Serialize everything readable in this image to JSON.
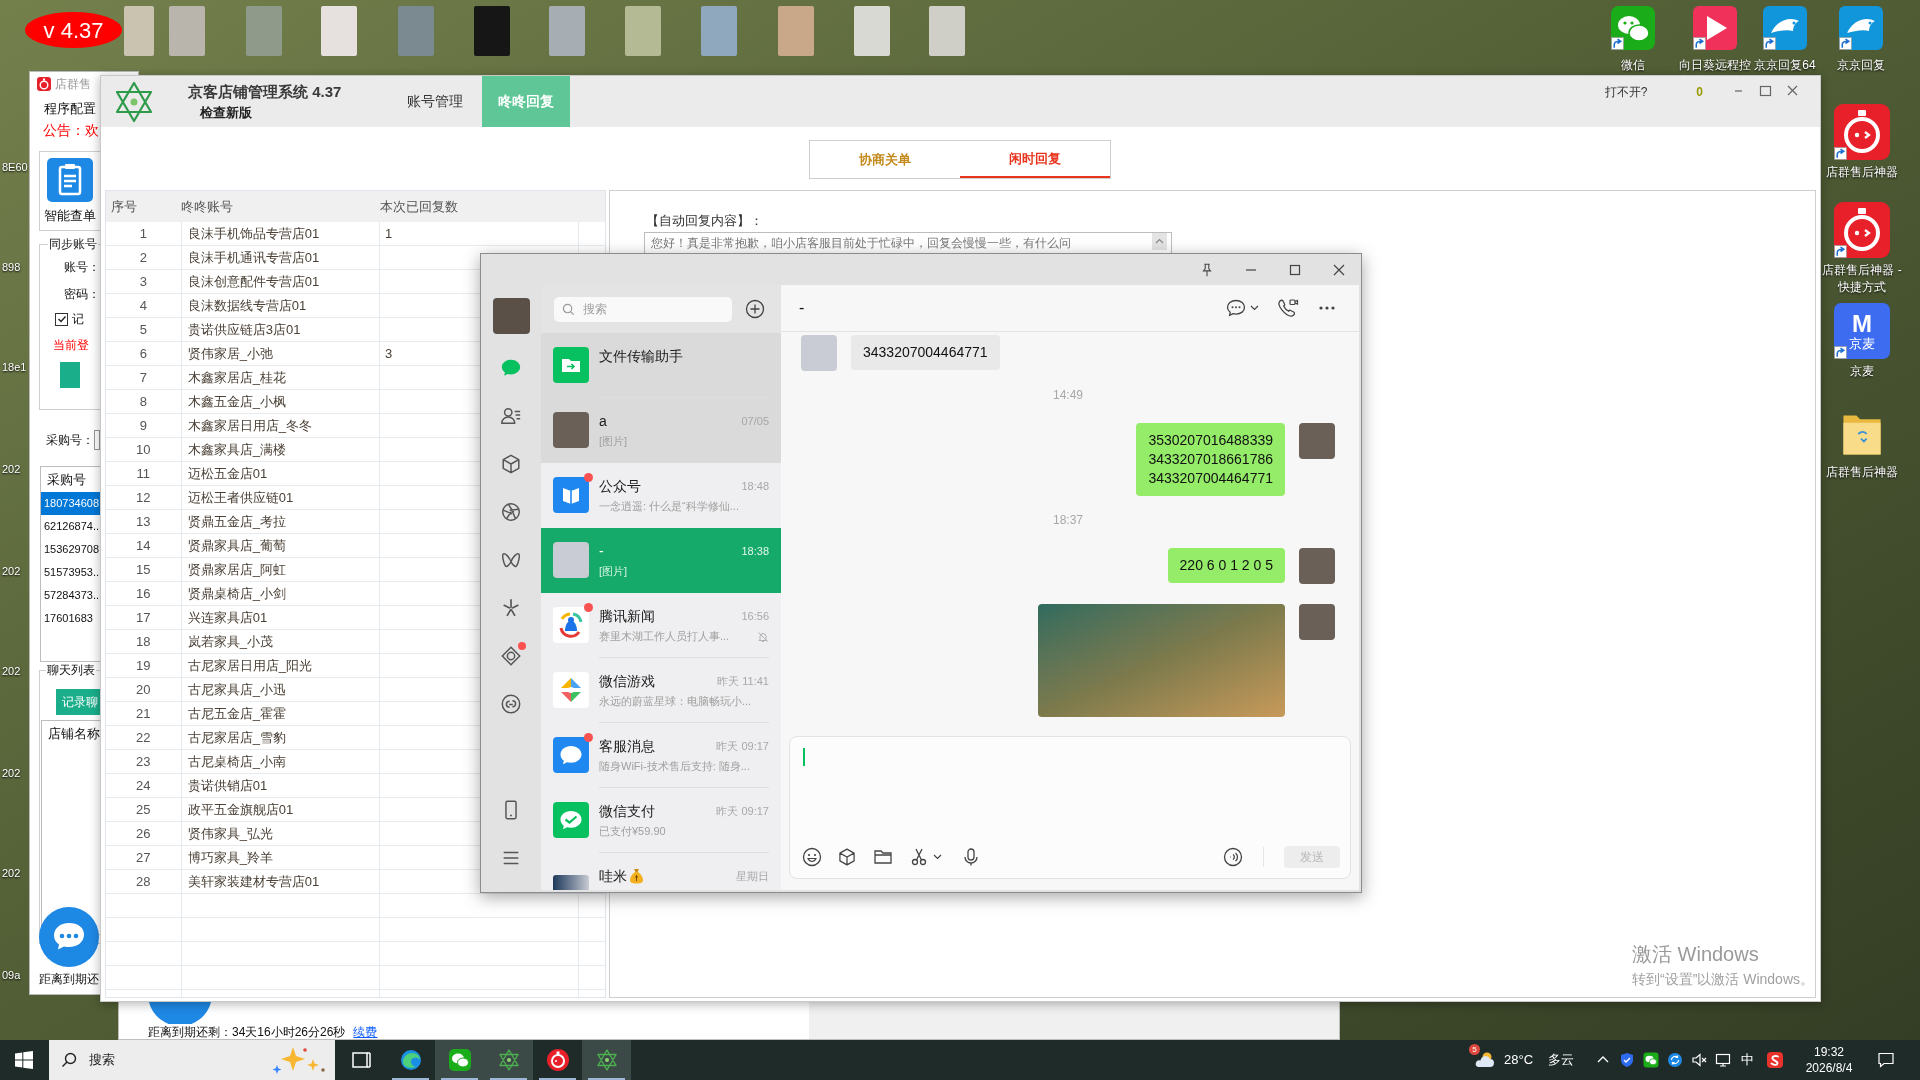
{
  "version_badge": "v 4.37",
  "desktop": {
    "left_labels": [
      "8E60",
      "898",
      "18e1",
      "202",
      "202",
      "202",
      "202",
      "202",
      "09a"
    ],
    "top_icons": [
      {
        "label": "微信",
        "kind": "wechat",
        "shortcut": true
      },
      {
        "label": "向日葵远程控",
        "kind": "remote",
        "shortcut": true
      },
      {
        "label": "京京回复64",
        "kind": "bird",
        "shortcut": true
      },
      {
        "label": "京京回复",
        "kind": "bird",
        "shortcut": true
      }
    ],
    "side_icons": [
      {
        "label": "店群售后神器",
        "kind": "alarm",
        "shortcut": true
      },
      {
        "label": "店群售后神器 - 快捷方式",
        "kind": "alarm",
        "shortcut": true
      },
      {
        "label": "京麦",
        "kind": "logo",
        "logo_letter": "M",
        "logo_text": "京麦",
        "shortcut": true
      },
      {
        "label": "店群售后神器",
        "kind": "folder",
        "shortcut": false
      }
    ]
  },
  "back_window": {
    "title": "店群售",
    "menu": "程序配置",
    "notice": "公告：欢",
    "tool": "智能查单",
    "sync": {
      "title": "同步账号",
      "account_label": "账号：",
      "password_label": "密码：",
      "remember": {
        "label": "记",
        "checked": true
      },
      "status": "当前登"
    },
    "purchase": {
      "label": "采购号：",
      "header": "采购号",
      "rows": [
        {
          "text": "180734608",
          "selected": true
        },
        {
          "text": "62126874..",
          "selected": false
        },
        {
          "text": "153629708",
          "selected": false
        },
        {
          "text": "51573953..",
          "selected": false
        },
        {
          "text": "57284373..",
          "selected": false
        },
        {
          "text": "17601683",
          "selected": false
        }
      ]
    },
    "chat_log": {
      "title": "聊天列表",
      "button": "记录聊",
      "list_header": "店铺名称"
    },
    "expiry": "距离到期还"
  },
  "lower_window": {
    "expiry": "距离到期还剩：34天16小时26分26秒",
    "renew": "续费"
  },
  "main_window": {
    "title": "京客店铺管理系统 4.37",
    "update": "检查新版",
    "nav_tabs": [
      {
        "label": "账号管理",
        "selected": false
      },
      {
        "label": "咚咚回复",
        "selected": true
      }
    ],
    "help": "打不开?",
    "counter": "0",
    "mode_tabs": [
      {
        "label": "协商关单",
        "selected": false
      },
      {
        "label": "闲时回复",
        "selected": true
      }
    ],
    "table": {
      "columns": [
        "序号",
        "咚咚账号",
        "本次已回复数"
      ],
      "rows": [
        {
          "no": "1",
          "account": "良沫手机饰品专营店01",
          "replies": "1"
        },
        {
          "no": "2",
          "account": "良沫手机通讯专营店01"
        },
        {
          "no": "3",
          "account": "良沫创意配件专营店01"
        },
        {
          "no": "4",
          "account": "良沫数据线专营店01"
        },
        {
          "no": "5",
          "account": "贵诺供应链店3店01"
        },
        {
          "no": "6",
          "account": "贤伟家居_小弛",
          "replies": "3"
        },
        {
          "no": "7",
          "account": "木鑫家居店_桂花"
        },
        {
          "no": "8",
          "account": "木鑫五金店_小枫"
        },
        {
          "no": "9",
          "account": "木鑫家居日用店_冬冬"
        },
        {
          "no": "10",
          "account": "木鑫家具店_满楼"
        },
        {
          "no": "11",
          "account": "迈松五金店01"
        },
        {
          "no": "12",
          "account": "迈松王者供应链01"
        },
        {
          "no": "13",
          "account": "贤鼎五金店_考拉"
        },
        {
          "no": "14",
          "account": "贤鼎家具店_葡萄"
        },
        {
          "no": "15",
          "account": "贤鼎家居店_阿虹"
        },
        {
          "no": "16",
          "account": "贤鼎桌椅店_小剑"
        },
        {
          "no": "17",
          "account": "兴连家具店01"
        },
        {
          "no": "18",
          "account": "岚若家具_小茂"
        },
        {
          "no": "19",
          "account": "古尼家居日用店_阳光"
        },
        {
          "no": "20",
          "account": "古尼家具店_小迅"
        },
        {
          "no": "21",
          "account": "古尼五金店_霍霍"
        },
        {
          "no": "22",
          "account": "古尼家居店_雪豹"
        },
        {
          "no": "23",
          "account": "古尼桌椅店_小南"
        },
        {
          "no": "24",
          "account": "贵诺供销店01"
        },
        {
          "no": "25",
          "account": "政平五金旗舰店01"
        },
        {
          "no": "26",
          "account": "贤伟家具_弘光"
        },
        {
          "no": "27",
          "account": "博巧家具_羚羊"
        },
        {
          "no": "28",
          "account": "美轩家装建材专营店01"
        }
      ]
    },
    "reply": {
      "label": "【自动回复内容】：",
      "text": "您好！真是非常抱歉，咱小店客服目前处于忙碌中，回复会慢慢一些，有什么问"
    }
  },
  "wechat": {
    "nav": [
      {
        "kind": "chat",
        "selected": true,
        "dot": false
      },
      {
        "kind": "contacts",
        "selected": false,
        "dot": false
      },
      {
        "kind": "cube",
        "selected": false,
        "dot": false
      },
      {
        "kind": "aperture",
        "selected": false,
        "dot": false
      },
      {
        "kind": "butterfly",
        "selected": false,
        "dot": false
      },
      {
        "kind": "sparkle",
        "selected": false,
        "dot": false
      },
      {
        "kind": "diamond",
        "selected": false,
        "dot": true
      },
      {
        "kind": "link",
        "selected": false,
        "dot": false
      }
    ],
    "bottom_nav": [
      {
        "kind": "phone"
      },
      {
        "kind": "menu"
      }
    ],
    "search": {
      "placeholder": "搜索"
    },
    "chats": [
      {
        "name": "文件传输助手",
        "avatar": {
          "kind": "file"
        },
        "pinned": true,
        "selected": false,
        "unread": false,
        "muted": false
      },
      {
        "name": "a",
        "time": "07/05",
        "preview": "[图片]",
        "avatar": {
          "kind": "photo"
        },
        "pinned": true,
        "selected": false,
        "unread": false,
        "muted": false
      },
      {
        "name": "公众号",
        "time": "18:48",
        "preview": "一念逍遥: 什么是“科学修仙...",
        "avatar": {
          "kind": "official"
        },
        "pinned": false,
        "selected": false,
        "unread": true,
        "muted": false
      },
      {
        "name": "-",
        "time": "18:38",
        "preview": "[图片]",
        "avatar": {
          "kind": "photo"
        },
        "pinned": false,
        "selected": true,
        "unread": false,
        "muted": false
      },
      {
        "name": "腾讯新闻",
        "time": "16:56",
        "preview": "赛里木湖工作人员打人事...",
        "avatar": {
          "kind": "news"
        },
        "pinned": false,
        "selected": false,
        "unread": true,
        "muted": true
      },
      {
        "name": "微信游戏",
        "time": "昨天 11:41",
        "preview": "永远的蔚蓝星球：电脑畅玩小...",
        "avatar": {
          "kind": "games"
        },
        "pinned": false,
        "selected": false,
        "unread": false,
        "muted": false
      },
      {
        "name": "客服消息",
        "time": "昨天 09:17",
        "preview": "随身WiFi-技术售后支持: 随身...",
        "avatar": {
          "kind": "service"
        },
        "pinned": false,
        "selected": false,
        "unread": true,
        "muted": false
      },
      {
        "name": "微信支付",
        "time": "昨天 09:17",
        "preview": "已支付¥59.90",
        "avatar": {
          "kind": "pay"
        },
        "pinned": false,
        "selected": false,
        "unread": false,
        "muted": false
      },
      {
        "name": "哇米",
        "time": "星期日",
        "avatar": {
          "kind": "group"
        },
        "emoji": true,
        "pinned": false,
        "selected": false,
        "unread": false,
        "muted": false
      }
    ],
    "chat": {
      "title": "-",
      "messages": [
        {
          "kind": "text",
          "outgoing": false,
          "text": "3433207004464771"
        },
        {
          "kind": "time",
          "text": "14:49"
        },
        {
          "kind": "text",
          "outgoing": true,
          "text": "3530207016488339\n3433207018661786\n3433207004464771"
        },
        {
          "kind": "time",
          "text": "18:37"
        },
        {
          "kind": "text",
          "outgoing": true,
          "text": "220 6 0 1 2 0 5"
        },
        {
          "kind": "image",
          "outgoing": true
        }
      ],
      "send": {
        "label": "发送",
        "disabled": true
      }
    }
  },
  "taskbar": {
    "search": {
      "placeholder": "搜索"
    },
    "apps": [
      {
        "kind": "task-view",
        "highlighted": false,
        "running": false
      },
      {
        "kind": "swirl",
        "highlighted": false,
        "running": true
      },
      {
        "kind": "wechat",
        "highlighted": true,
        "running": true
      },
      {
        "kind": "hexagram",
        "highlighted": true,
        "running": true
      },
      {
        "kind": "stopwatch",
        "highlighted": false,
        "running": true
      },
      {
        "kind": "hexagram",
        "highlighted": true,
        "running": true
      }
    ],
    "weather": {
      "badge": "5",
      "temperature": "28°C",
      "condition": "多云"
    },
    "tray": [
      {
        "kind": "chevron"
      },
      {
        "kind": "shield"
      },
      {
        "kind": "wechat"
      },
      {
        "kind": "sync"
      },
      {
        "kind": "mute"
      },
      {
        "kind": "monitor"
      }
    ],
    "ime": "中",
    "clock": {
      "time": "19:32",
      "date": "2026/8/4"
    }
  },
  "activation_notice": {
    "title": "激活 Windows",
    "subtitle": "转到“设置”以激活 Windows。"
  }
}
